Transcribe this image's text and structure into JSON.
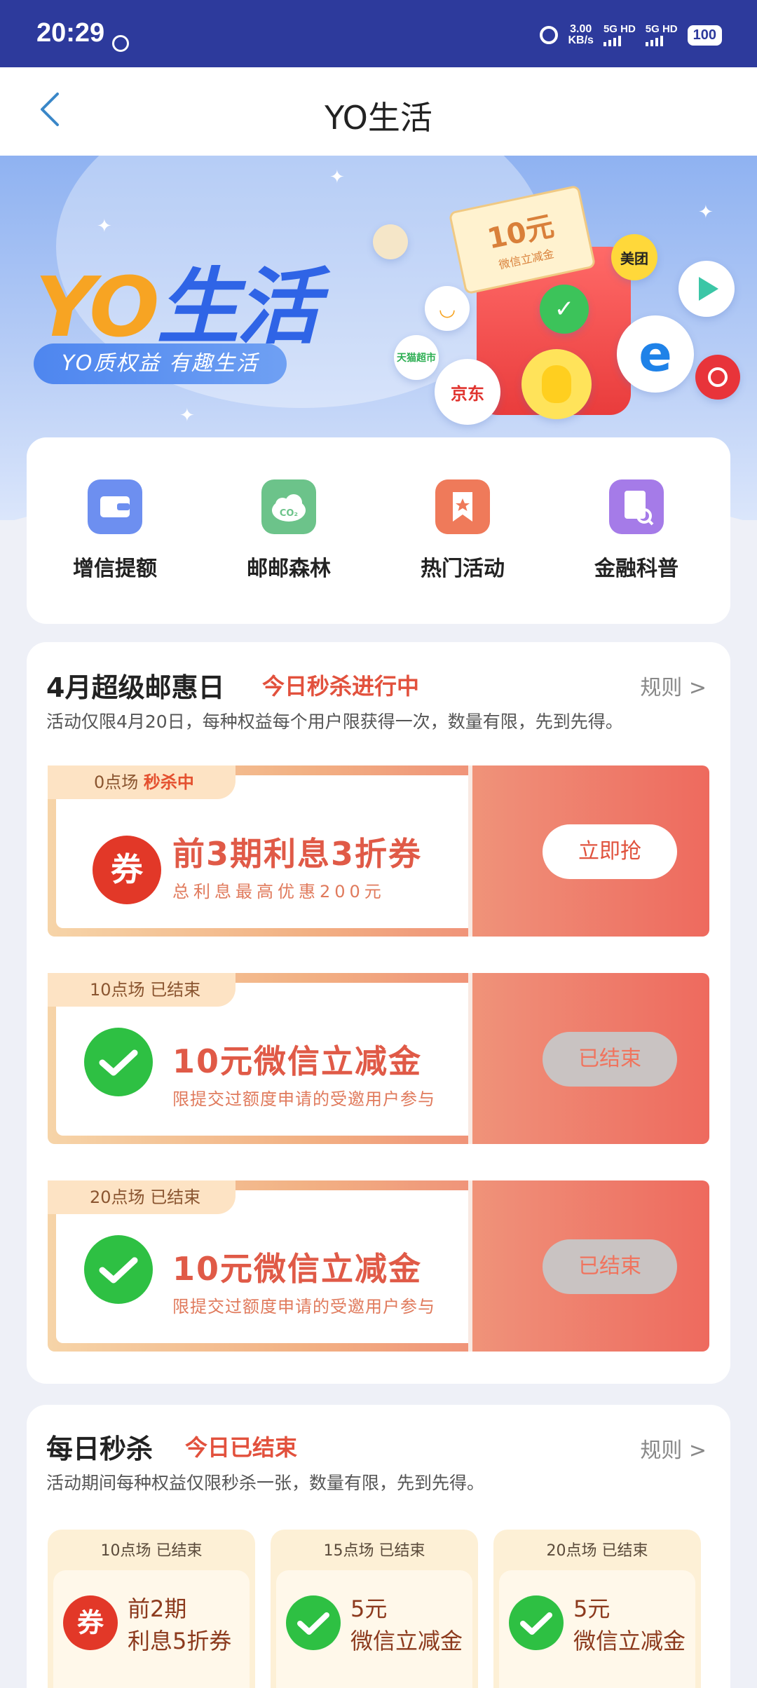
{
  "status_bar": {
    "time": "20:29",
    "speed_value": "3.00",
    "speed_unit": "KB/s",
    "net1": "5G HD",
    "net2": "5G HD",
    "battery": "100"
  },
  "nav": {
    "title": "YO生活"
  },
  "banner": {
    "brand_yo": "YO",
    "brand_life": "生活",
    "slogan": "YO质权益 有趣生活",
    "ticket_amount": "10元",
    "ticket_caption": "微信立减金",
    "brands": [
      "美团",
      "京东",
      "天猫超市"
    ]
  },
  "quick_menu": [
    {
      "label": "增信提额",
      "icon": "wallet-icon",
      "color": "#6d8ff0"
    },
    {
      "label": "邮邮森林",
      "icon": "co2-cloud-icon",
      "color": "#6cc38a"
    },
    {
      "label": "热门活动",
      "icon": "bookmark-star-icon",
      "color": "#ef7a5a"
    },
    {
      "label": "金融科普",
      "icon": "doc-search-icon",
      "color": "#a57be8"
    }
  ],
  "super_day": {
    "title": "4月超级邮惠日",
    "status": "今日秒杀进行中",
    "rule": "规则 >",
    "desc": "活动仅限4月20日，每种权益每个用户限获得一次，数量有限，先到先得。",
    "coupons": [
      {
        "session": "0点场",
        "session_status": "秒杀中",
        "title": "前3期利息3折券",
        "subtitle": "总利息最高优惠200元",
        "button": "立即抢",
        "icon": "coupon-icon"
      },
      {
        "session": "10点场",
        "session_status": "已结束",
        "title": "10元微信立减金",
        "subtitle": "限提交过额度申请的受邀用户参与",
        "button": "已结束",
        "icon": "wechat-icon"
      },
      {
        "session": "20点场",
        "session_status": "已结束",
        "title": "10元微信立减金",
        "subtitle": "限提交过额度申请的受邀用户参与",
        "button": "已结束",
        "icon": "wechat-icon"
      }
    ]
  },
  "daily": {
    "title": "每日秒杀",
    "status": "今日已结束",
    "rule": "规则 >",
    "desc": "活动期间每种权益仅限秒杀一张，数量有限，先到先得。",
    "cards": [
      {
        "head": "10点场 已结束",
        "line1": "前2期",
        "line2": "利息5折券",
        "icon": "coupon-icon"
      },
      {
        "head": "15点场 已结束",
        "line1": "5元",
        "line2": "微信立减金",
        "icon": "wechat-icon"
      },
      {
        "head": "20点场 已结束",
        "line1": "5元",
        "line2": "微信立减金",
        "icon": "wechat-icon"
      }
    ]
  },
  "colors": {
    "accent_red": "#e2513d",
    "status_bar": "#2d3a9c",
    "brand_blue": "#2f64e6",
    "brand_orange": "#f7a423"
  }
}
